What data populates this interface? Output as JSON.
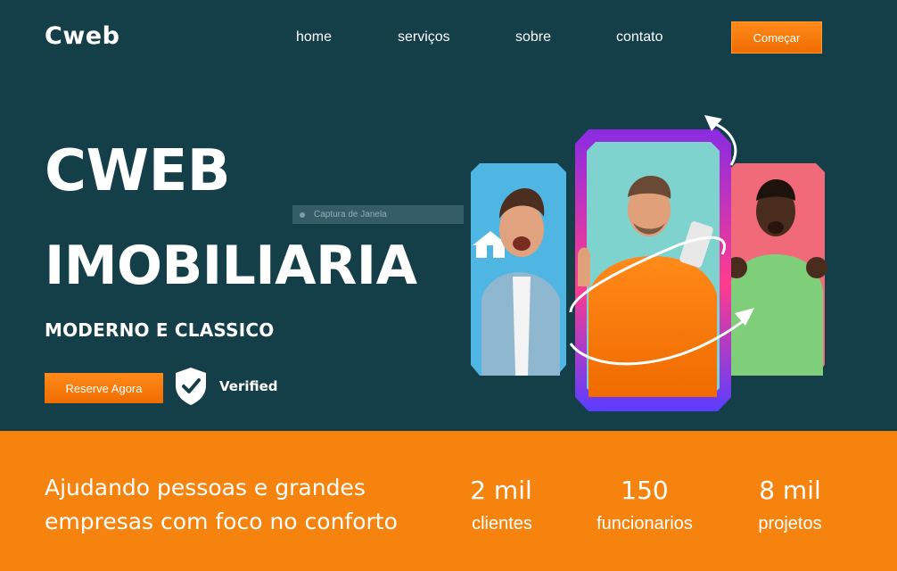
{
  "brand": {
    "logo": "Cweb"
  },
  "nav": {
    "links": [
      "home",
      "serviços",
      "sobre",
      "contato"
    ],
    "cta": "Começar"
  },
  "hero": {
    "title_line1": "CWEB",
    "title_line2": "IMOBILIARIA",
    "subtitle": "MODERNO E CLASSICO",
    "reserve_button": "Reserve Agora",
    "verified_label": "Verified",
    "overlay_window_title": "Captura de Janela"
  },
  "stats": {
    "tagline": "Ajudando pessoas e grandes empresas com foco no conforto",
    "items": [
      {
        "value": "2 mil",
        "label": "clientes"
      },
      {
        "value": "150",
        "label": "funcionarios"
      },
      {
        "value": "8 mil",
        "label": "projetos"
      }
    ]
  },
  "colors": {
    "hero_bg": "#143f49",
    "accent_orange": "#f7830f",
    "button_orange": "#f47a06",
    "card_blue": "#4fb6e3",
    "card_teal": "#7fd3cf",
    "card_pink": "#f06a7a",
    "frame_gradient": [
      "#8a2be2",
      "#ff3c8e",
      "#ff8a1a"
    ]
  },
  "icons": [
    "shield-check-icon",
    "house-icon",
    "curved-arrow-icon"
  ]
}
